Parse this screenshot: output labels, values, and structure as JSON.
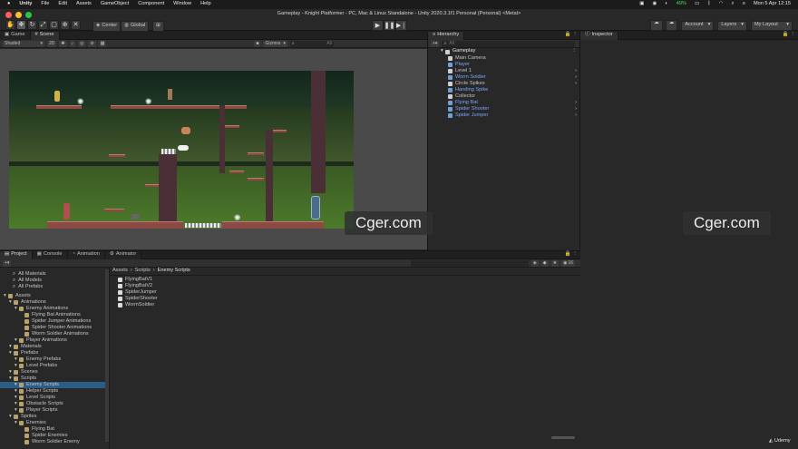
{
  "menubar": {
    "apple": "",
    "items": [
      "Unity",
      "File",
      "Edit",
      "Assets",
      "GameObject",
      "Component",
      "Window",
      "Help"
    ],
    "battery": "49%",
    "datetime": "Mon 5 Apr  12:15"
  },
  "window": {
    "title": "Gameplay - Knight Platformer - PC, Mac & Linux Standalone - Unity 2020.3.1f1 Personal (Personal) <Metal>"
  },
  "toolbar": {
    "pivot_label": "Center",
    "space_label": "Global",
    "account_label": "Account",
    "layers_label": "Layers",
    "layout_label": "My Layout"
  },
  "scene": {
    "tabs": [
      "Game",
      "Scene"
    ],
    "shading": "Shaded",
    "mode_2d": "2D",
    "gizmos": "Gizmos",
    "search_placeholder": "All"
  },
  "hierarchy": {
    "tab": "Hierarchy",
    "search_placeholder": "All",
    "root": "Gameplay",
    "items": [
      {
        "name": "Main Camera",
        "color": "white",
        "arrow": false
      },
      {
        "name": "Player",
        "color": "blue",
        "arrow": false
      },
      {
        "name": "Level 1",
        "color": "white",
        "arrow": true
      },
      {
        "name": "Worm Soldier",
        "color": "blue",
        "arrow": true
      },
      {
        "name": "Circle Spikes",
        "color": "white",
        "arrow": true
      },
      {
        "name": "Handing Spike",
        "color": "blue",
        "arrow": false
      },
      {
        "name": "Collector",
        "color": "white",
        "arrow": false
      },
      {
        "name": "Flying Bat",
        "color": "blue",
        "arrow": true
      },
      {
        "name": "Spider Shooter",
        "color": "blue",
        "arrow": true
      },
      {
        "name": "Spider Jumper",
        "color": "blue",
        "arrow": true
      }
    ]
  },
  "inspector": {
    "tab": "Inspector"
  },
  "bottom": {
    "tabs": [
      "Project",
      "Console",
      "Animation",
      "Animator"
    ],
    "favorites": [
      "All Materials",
      "All Models",
      "All Prefabs"
    ],
    "tree": [
      {
        "name": "Assets",
        "depth": 0
      },
      {
        "name": "Animations",
        "depth": 1
      },
      {
        "name": "Enemy Animations",
        "depth": 2
      },
      {
        "name": "Flying Bat Animations",
        "depth": 3
      },
      {
        "name": "Spider Jumper Animations",
        "depth": 3
      },
      {
        "name": "Spider Shooter Animations",
        "depth": 3
      },
      {
        "name": "Worm Soldier Animations",
        "depth": 3
      },
      {
        "name": "Player Animations",
        "depth": 2
      },
      {
        "name": "Materials",
        "depth": 1
      },
      {
        "name": "Prefabs",
        "depth": 1
      },
      {
        "name": "Enemy Prefabs",
        "depth": 2
      },
      {
        "name": "Level Prefabs",
        "depth": 2
      },
      {
        "name": "Scenes",
        "depth": 1
      },
      {
        "name": "Scripts",
        "depth": 1
      },
      {
        "name": "Enemy Scripts",
        "depth": 2,
        "selected": true
      },
      {
        "name": "Helper Scripts",
        "depth": 2
      },
      {
        "name": "Level Scripts",
        "depth": 2
      },
      {
        "name": "Obstacle Scripts",
        "depth": 2
      },
      {
        "name": "Player Scripts",
        "depth": 2
      },
      {
        "name": "Sprites",
        "depth": 1
      },
      {
        "name": "Enemies",
        "depth": 2
      },
      {
        "name": "Flying Bat",
        "depth": 3
      },
      {
        "name": "Spider Enemies",
        "depth": 3
      },
      {
        "name": "Worm Soldier Enemy",
        "depth": 3
      }
    ],
    "breadcrumb": [
      "Assets",
      "Scripts",
      "Enemy Scripts"
    ],
    "files": [
      "FlyingBatV1",
      "FlyingBatV2",
      "SpiderJumper",
      "SpiderShooter",
      "WormSoldier"
    ],
    "hidden_count": "16"
  },
  "watermark": "Cger.com",
  "udemy": "Udemy",
  "colors": {
    "accent": "#2c5d87",
    "blue_text": "#7aa4ff",
    "brick": "#8c4a44"
  }
}
